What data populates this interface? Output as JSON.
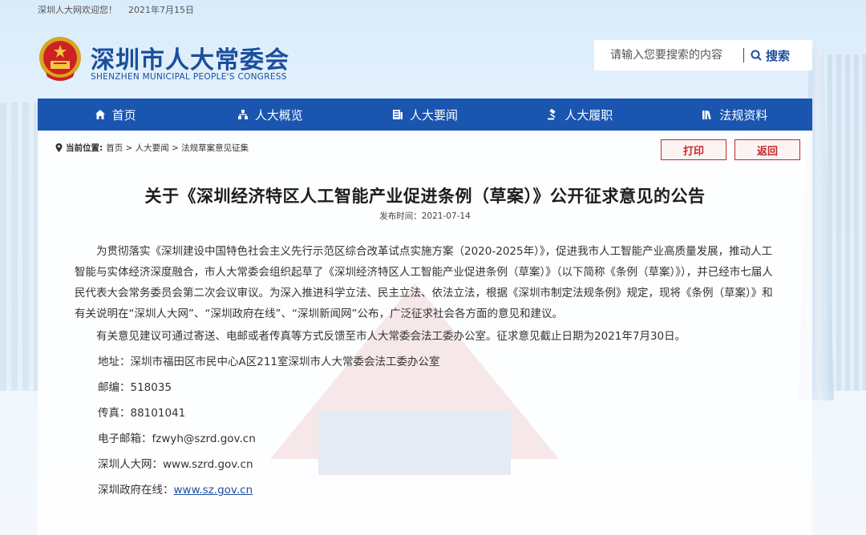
{
  "topbar": {
    "welcome": "深圳人大网欢迎您！",
    "date": "2021年7月15日"
  },
  "brand": {
    "title": "深圳市人大常委会",
    "subtitle": "SHENZHEN MUNICIPAL PEOPLE'S CONGRESS"
  },
  "search": {
    "placeholder": "请输入您要搜索的内容",
    "button": "搜索"
  },
  "nav": [
    {
      "label": "首页",
      "icon": "home-icon"
    },
    {
      "label": "人大概览",
      "icon": "org-chart-icon"
    },
    {
      "label": "人大要闻",
      "icon": "news-icon"
    },
    {
      "label": "人大履职",
      "icon": "gavel-icon"
    },
    {
      "label": "法规资料",
      "icon": "books-icon"
    }
  ],
  "breadcrumb": {
    "label": "当前位置:",
    "path": "首页 > 人大要闻 > 法规草案意见征集"
  },
  "actions": {
    "print": "打印",
    "back": "返回"
  },
  "article": {
    "title": "关于《深圳经济特区人工智能产业促进条例（草案）》公开征求意见的公告",
    "publish_time": "发布时间：2021-07-14",
    "paragraphs": [
      "为贯彻落实《深圳建设中国特色社会主义先行示范区综合改革试点实施方案（2020-2025年）》，促进我市人工智能产业高质量发展，推动人工智能与实体经济深度融合，市人大常委会组织起草了《深圳经济特区人工智能产业促进条例（草案）》（以下简称《条例（草案）》），并已经市七届人民代表大会常务委员会第二次会议审议。为深入推进科学立法、民主立法、依法立法，根据《深圳市制定法规条例》规定，现将《条例（草案）》和有关说明在“深圳人大网”、“深圳政府在线”、“深圳新闻网”公布，广泛征求社会各方面的意见和建议。",
      "有关意见建议可通过寄送、电邮或者传真等方式反馈至市人大常委会法工委办公室。征求意见截止日期为2021年7月30日。"
    ],
    "contacts": {
      "address": "地址：深圳市福田区市民中心A区211室深圳市人大常委会法工委办公室",
      "postcode": "邮编：518035",
      "fax": "传真：88101041",
      "email_label": "电子邮箱：",
      "email": "fzwyh@szrd.gov.cn",
      "szrd_label": "深圳人大网：",
      "szrd_url": "www.szrd.gov.cn",
      "gov_label": "深圳政府在线：",
      "gov_url": "www.sz.gov.cn"
    }
  },
  "colors": {
    "brand_blue": "#1b4f9c",
    "nav_blue": "#1a55b0",
    "action_red": "#c0292b"
  }
}
